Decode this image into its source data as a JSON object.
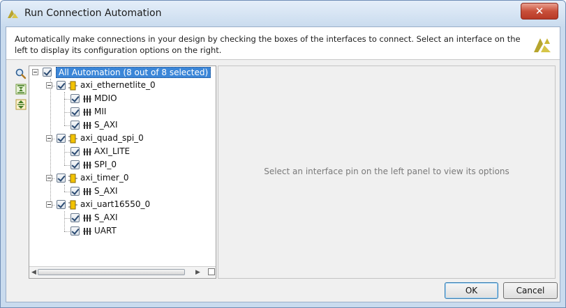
{
  "window": {
    "title": "Run Connection Automation",
    "close_glyph": "✕"
  },
  "banner": {
    "description": "Automatically make connections in your design by checking the boxes of the interfaces to connect. Select an interface on the left to display its configuration options on the right.",
    "logo_icon": "vivado-logo-icon"
  },
  "side_tools": [
    {
      "icon": "search-icon"
    },
    {
      "icon": "collapse-all-icon"
    },
    {
      "icon": "expand-all-icon"
    }
  ],
  "tree": {
    "root_label": "All Automation (8 out of 8 selected)",
    "ips": [
      {
        "name": "axi_ethernetlite_0",
        "checked": true,
        "interfaces": [
          {
            "name": "MDIO",
            "checked": true
          },
          {
            "name": "MII",
            "checked": true
          },
          {
            "name": "S_AXI",
            "checked": true
          }
        ]
      },
      {
        "name": "axi_quad_spi_0",
        "checked": true,
        "interfaces": [
          {
            "name": "AXI_LITE",
            "checked": true
          },
          {
            "name": "SPI_0",
            "checked": true
          }
        ]
      },
      {
        "name": "axi_timer_0",
        "checked": true,
        "interfaces": [
          {
            "name": "S_AXI",
            "checked": true
          }
        ]
      },
      {
        "name": "axi_uart16550_0",
        "checked": true,
        "interfaces": [
          {
            "name": "S_AXI",
            "checked": true
          },
          {
            "name": "UART",
            "checked": true
          }
        ]
      }
    ]
  },
  "options_panel": {
    "placeholder": "Select an interface pin on the left panel to view its options"
  },
  "buttons": {
    "ok": "OK",
    "cancel": "Cancel"
  },
  "colors": {
    "selection": "#3b86d8",
    "ip_icon": "#e8b000",
    "logo": "#c9b735"
  }
}
